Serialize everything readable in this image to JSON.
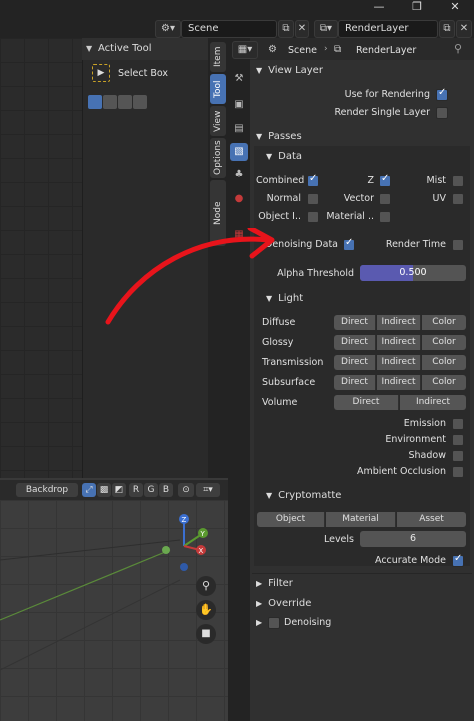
{
  "window": {
    "restore_icon": "restore-icon",
    "close_icon": "close-icon"
  },
  "topbar": {
    "scene_value": "Scene",
    "renderlayer_value": "RenderLayer"
  },
  "npanel": {
    "title": "Active Tool",
    "tool_name": "Select Box",
    "tabs": [
      "Item",
      "Tool",
      "View",
      "Options",
      "Node Wrangler"
    ],
    "active_tab": "Tool"
  },
  "properties_header": {
    "scene": "Scene",
    "layer": "RenderLayer"
  },
  "viewport_header": {
    "backdrop": "Backdrop",
    "channels": [
      "R",
      "G",
      "B"
    ]
  },
  "view_layer": {
    "title": "View Layer",
    "use_for_rendering": "Use for Rendering",
    "use_for_rendering_checked": true,
    "render_single_layer": "Render Single Layer",
    "render_single_layer_checked": false
  },
  "passes": {
    "title": "Passes",
    "data": {
      "title": "Data",
      "combined": "Combined",
      "combined_checked": true,
      "z": "Z",
      "z_checked": true,
      "mist": "Mist",
      "mist_checked": false,
      "normal": "Normal",
      "normal_checked": false,
      "vector": "Vector",
      "vector_checked": false,
      "uv": "UV",
      "uv_checked": false,
      "object_index": "Object I..",
      "object_index_checked": false,
      "material_index": "Material ..",
      "material_index_checked": false,
      "denoising_data": "Denoising Data",
      "denoising_data_checked": true,
      "render_time": "Render Time",
      "render_time_checked": false,
      "alpha_threshold_label": "Alpha Threshold",
      "alpha_threshold_value": "0.500",
      "alpha_threshold_fraction": 0.5
    },
    "light": {
      "title": "Light",
      "rows": [
        {
          "label": "Diffuse",
          "buttons": [
            "Direct",
            "Indirect",
            "Color"
          ]
        },
        {
          "label": "Glossy",
          "buttons": [
            "Direct",
            "Indirect",
            "Color"
          ]
        },
        {
          "label": "Transmission",
          "buttons": [
            "Direct",
            "Indirect",
            "Color"
          ]
        },
        {
          "label": "Subsurface",
          "buttons": [
            "Direct",
            "Indirect",
            "Color"
          ]
        },
        {
          "label": "Volume",
          "buttons": [
            "Direct",
            "Indirect"
          ]
        }
      ],
      "emission": "Emission",
      "environment": "Environment",
      "shadow": "Shadow",
      "ambient_occlusion": "Ambient Occlusion"
    },
    "cryptomatte": {
      "title": "Cryptomatte",
      "buttons": [
        "Object",
        "Material",
        "Asset"
      ],
      "levels_label": "Levels",
      "levels_value": "6",
      "accurate_mode": "Accurate Mode",
      "accurate_mode_checked": true
    }
  },
  "collapsed_panels": {
    "filter": "Filter",
    "override": "Override",
    "denoising": "Denoising"
  },
  "annotation": {
    "color": "#e8141b"
  }
}
